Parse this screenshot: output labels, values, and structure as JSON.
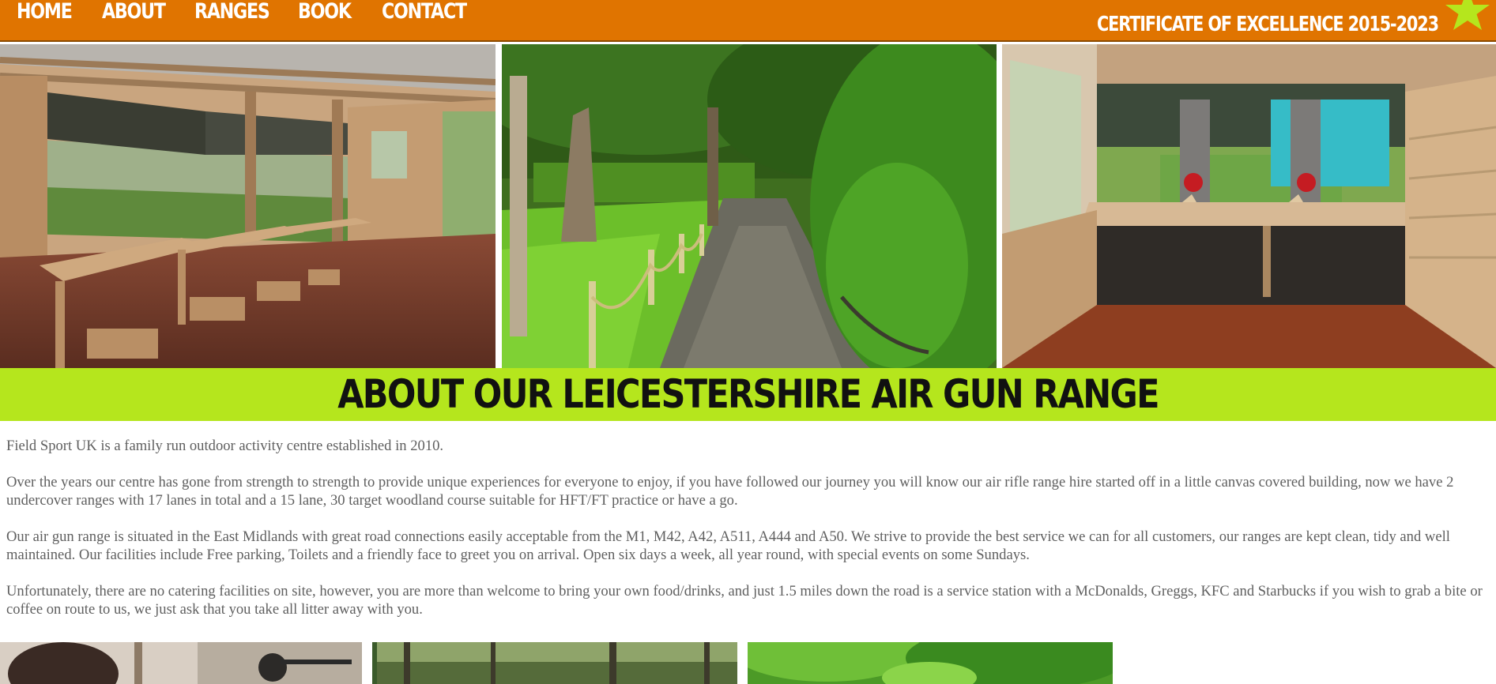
{
  "nav": {
    "items": [
      "HOME",
      "ABOUT",
      "RANGES",
      "BOOK",
      "CONTACT"
    ],
    "certificate": "CERTIFICATE OF EXCELLENCE 2015-2023",
    "background": "#e07400",
    "star_icon": "star-icon",
    "star_color": "#b5e61d"
  },
  "hero": {
    "photos": [
      {
        "name": "covered-range-photo",
        "subject": "undercover range benches"
      },
      {
        "name": "woodland-path-photo",
        "subject": "woodland path with rope fence"
      },
      {
        "name": "shooting-lane-photo",
        "subject": "shooting lane with targets"
      }
    ]
  },
  "about": {
    "heading": "ABOUT OUR LEICESTERSHIRE AIR GUN RANGE",
    "band_color": "#b5e61d",
    "paragraphs": [
      "Field Sport UK is a family run outdoor activity centre established in 2010.",
      "Over the years our centre has gone from strength to strength to provide unique experiences for everyone to enjoy, if you have followed our journey you will know our air rifle range hire started off in a little canvas covered building, now we have 2 undercover ranges with 17 lanes in total and a 15 lane, 30 target woodland course suitable for HFT/FT practice or have a go.",
      "Our air gun range is situated in the East Midlands with great road connections easily acceptable from the M1, M42, A42, A511, A444 and A50. We strive to provide the best service we can for all customers, our ranges are kept clean, tidy and well maintained. Our facilities include Free parking, Toilets and a friendly face to greet you on arrival. Open six days a week, all year round, with special events on some Sundays.",
      "Unfortunately, there are no catering facilities on site, however, you are more than welcome to bring your own food/drinks, and just 1.5 miles down the road is a service station with a McDonalds, Greggs, KFC and Starbucks if you wish to grab a bite or coffee on route to us, we just ask that you take all litter away with you."
    ]
  },
  "gallery": {
    "photos": [
      {
        "name": "shooter-photo"
      },
      {
        "name": "woodland-course-photo"
      },
      {
        "name": "green-trees-photo"
      }
    ]
  }
}
